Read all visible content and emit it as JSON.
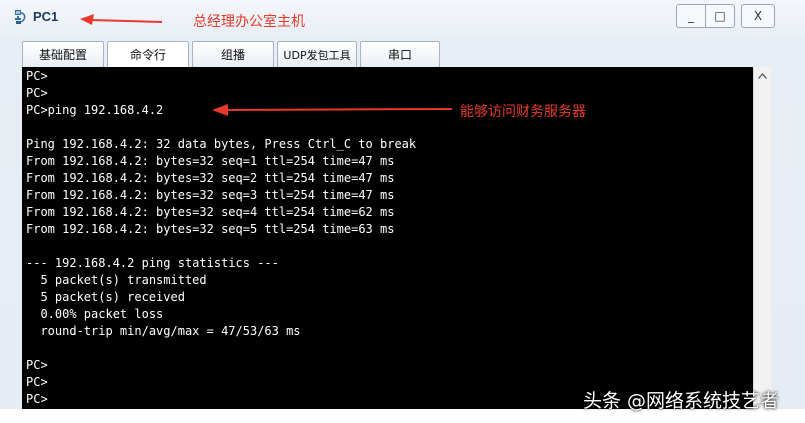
{
  "window": {
    "title": "PC1",
    "controls": {
      "minimize": "_",
      "maximize": "□",
      "close": "X"
    }
  },
  "annotations": {
    "title_note": "总经理办公室主机",
    "ping_note": "能够访问财务服务器",
    "color": "#e8392c"
  },
  "tabs": [
    {
      "label": "基础配置",
      "active": false
    },
    {
      "label": "命令行",
      "active": true
    },
    {
      "label": "组播",
      "active": false
    },
    {
      "label": "UDP发包工具",
      "active": false
    },
    {
      "label": "串口",
      "active": false
    }
  ],
  "terminal": {
    "lines": [
      "PC>",
      "PC>",
      "PC>ping 192.168.4.2",
      "",
      "Ping 192.168.4.2: 32 data bytes, Press Ctrl_C to break",
      "From 192.168.4.2: bytes=32 seq=1 ttl=254 time=47 ms",
      "From 192.168.4.2: bytes=32 seq=2 ttl=254 time=47 ms",
      "From 192.168.4.2: bytes=32 seq=3 ttl=254 time=47 ms",
      "From 192.168.4.2: bytes=32 seq=4 ttl=254 time=62 ms",
      "From 192.168.4.2: bytes=32 seq=5 ttl=254 time=63 ms",
      "",
      "--- 192.168.4.2 ping statistics ---",
      "  5 packet(s) transmitted",
      "  5 packet(s) received",
      "  0.00% packet loss",
      "  round-trip min/avg/max = 47/53/63 ms",
      "",
      "PC>",
      "PC>",
      "PC>"
    ]
  },
  "watermark": "头条 @网络系统技艺者"
}
